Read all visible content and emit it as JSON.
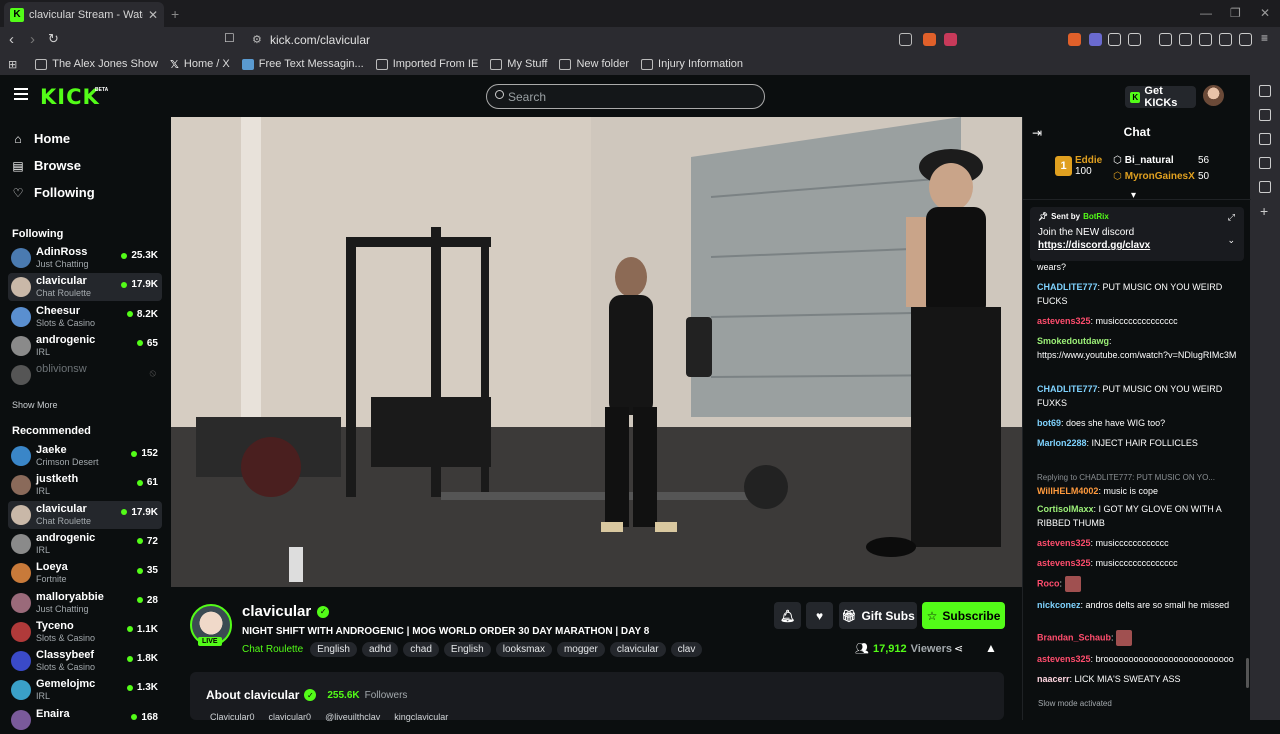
{
  "browser": {
    "tab_title": "clavicular Stream - Watch Live",
    "url": "kick.com/clavicular",
    "bookmarks": [
      {
        "label": "The Alex Jones Show",
        "icon": "page-icon"
      },
      {
        "label": "Home / X",
        "icon": "x-icon"
      },
      {
        "label": "Free Text Messagin...",
        "icon": "page-icon"
      },
      {
        "label": "Imported From IE",
        "icon": "folder-icon"
      },
      {
        "label": "My Stuff",
        "icon": "folder-icon"
      },
      {
        "label": "New folder",
        "icon": "folder-icon"
      },
      {
        "label": "Injury Information",
        "icon": "folder-icon"
      }
    ]
  },
  "header": {
    "logo": "KICK",
    "beta": "BETA",
    "search_placeholder": "Search",
    "get_kicks": "Get KICKs"
  },
  "sidebar": {
    "nav": [
      {
        "label": "Home",
        "icon": "home-icon"
      },
      {
        "label": "Browse",
        "icon": "browse-icon"
      },
      {
        "label": "Following",
        "icon": "heart-icon"
      }
    ],
    "following_title": "Following",
    "following": [
      {
        "name": "AdinRoss",
        "category": "Just Chatting",
        "viewers": "25.3K",
        "color": "#4a7ab0"
      },
      {
        "name": "clavicular",
        "category": "Chat Roulette",
        "viewers": "17.9K",
        "color": "#c9b8a8",
        "active": true
      },
      {
        "name": "Cheesur",
        "category": "Slots & Casino",
        "viewers": "8.2K",
        "color": "#5a8fd0"
      },
      {
        "name": "androgenic",
        "category": "IRL",
        "viewers": "65",
        "color": "#8a8a8a"
      },
      {
        "name": "oblivionsw",
        "category": "",
        "viewers": "",
        "color": "#555",
        "offline": true
      }
    ],
    "show_more": "Show More",
    "recommended_title": "Recommended",
    "recommended": [
      {
        "name": "Jaeke",
        "category": "Crimson Desert",
        "viewers": "152",
        "color": "#3a86c8"
      },
      {
        "name": "justketh",
        "category": "IRL",
        "viewers": "61",
        "color": "#8a6a5a"
      },
      {
        "name": "clavicular",
        "category": "Chat Roulette",
        "viewers": "17.9K",
        "color": "#c9b8a8",
        "active": true
      },
      {
        "name": "androgenic",
        "category": "IRL",
        "viewers": "72",
        "color": "#8a8a8a"
      },
      {
        "name": "Loeya",
        "category": "Fortnite",
        "viewers": "35",
        "color": "#c87a3a"
      },
      {
        "name": "malloryabbie",
        "category": "Just Chatting",
        "viewers": "28",
        "color": "#9a6a7a"
      },
      {
        "name": "Tyceno",
        "category": "Slots & Casino",
        "viewers": "1.1K",
        "color": "#b03a3a"
      },
      {
        "name": "Classybeef",
        "category": "Slots & Casino",
        "viewers": "1.8K",
        "color": "#3a4ac8"
      },
      {
        "name": "Gemelojmc",
        "category": "IRL",
        "viewers": "1.3K",
        "color": "#3aa0c8"
      },
      {
        "name": "Enaira",
        "category": "",
        "viewers": "168",
        "color": "#7a5a9a"
      }
    ]
  },
  "stream": {
    "streamer": "clavicular",
    "live_label": "LIVE",
    "title": "NIGHT SHIFT WITH ANDROGENIC | MOG WORLD ORDER 30 DAY MARATHON | DAY 8",
    "category": "Chat Roulette",
    "tags": [
      "English",
      "adhd",
      "chad",
      "English",
      "looksmax",
      "mogger",
      "clavicular",
      "clav"
    ],
    "gift_subs": "Gift Subs",
    "subscribe": "Subscribe",
    "viewers": "17,912",
    "viewers_label": "Viewers",
    "about_title": "About clavicular",
    "followers": "255.6K",
    "followers_label": "Followers",
    "socials": [
      "Clavicular0",
      "clavicular0",
      "@liveuilthclav",
      "kingclavicular"
    ]
  },
  "chat": {
    "title": "Chat",
    "leaderboard": [
      {
        "rank": "1",
        "name": "Eddie",
        "amount": "100"
      },
      {
        "name": "Bi_natural",
        "amount": "56"
      },
      {
        "name": "MyronGainesX",
        "amount": "50"
      }
    ],
    "pinned": {
      "sent_by": "Sent by",
      "bot": "BotRix",
      "line1": "Join the NEW discord",
      "line2": "https://discord.gg/clavx"
    },
    "messages": [
      {
        "user": "",
        "text": "wears?",
        "color": "#fff"
      },
      {
        "user": "CHADLITE777",
        "text": "PUT MUSIC ON YOU WEIRD FUCKS",
        "color": "#7fd3ff"
      },
      {
        "user": "astevens325",
        "text": "musicccccccccccccc",
        "color": "#ff4d6d"
      },
      {
        "user": "Smokedoutdawg",
        "text": "https://www.youtube.com/watch?v=NDlugRIMc3M",
        "color": "#9cf078"
      },
      {
        "user": "CHADLITE777",
        "text": "PUT MUSIC ON YOU WEIRD FUXKS",
        "color": "#7fd3ff"
      },
      {
        "user": "bot69",
        "text": "does she have WIG too?",
        "color": "#7fd3ff"
      },
      {
        "user": "Marlon2288",
        "text": "INJECT HAIR FOLLICLES",
        "color": "#7fd3ff"
      },
      {
        "user": "",
        "text": "Replying to CHADLITE777: PUT MUSIC ON YO...",
        "color": "#8a8f93"
      },
      {
        "user": "WillHELM4002",
        "text": "music is cope",
        "color": "#ff9a3d"
      },
      {
        "user": "CortisolMaxx",
        "text": "I GOT MY GLOVE ON WITH A RIBBED THUMB",
        "color": "#9cf078"
      },
      {
        "user": "astevens325",
        "text": "musicccccccccccc",
        "color": "#ff4d6d"
      },
      {
        "user": "astevens325",
        "text": "musicccccccccccccc",
        "color": "#ff4d6d"
      },
      {
        "user": "Roco",
        "text": "",
        "color": "#ff4d6d"
      },
      {
        "user": "nickconez",
        "text": "andros delts are so small he missed",
        "color": "#7fd3ff"
      },
      {
        "user": "Brandan_Schaub",
        "text": "",
        "color": "#ff4d6d"
      },
      {
        "user": "astevens325",
        "text": "broooooooooooooooooooooooooo",
        "color": "#ff4d6d"
      },
      {
        "user": "naacerr",
        "text": "LICK MIA'S SWEATY ASS",
        "color": "#ffd6e0"
      }
    ],
    "slow_mode": "Slow mode activated"
  }
}
